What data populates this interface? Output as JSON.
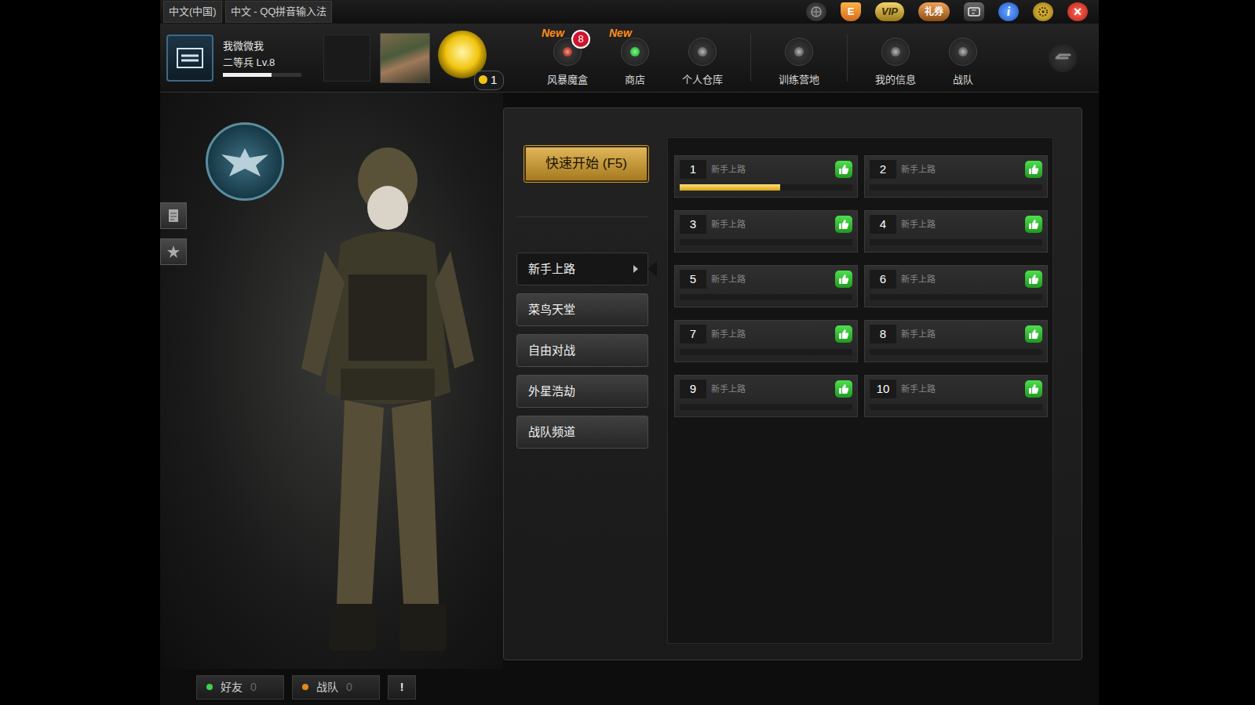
{
  "ime": [
    "中文(中国)",
    "中文 - QQ拼音输入法"
  ],
  "systemIcons": [
    {
      "kind": "globe"
    },
    {
      "kind": "badge",
      "label": "E"
    },
    {
      "kind": "pill",
      "label": "VIP"
    },
    {
      "kind": "pillalt",
      "label": "礼券"
    },
    {
      "kind": "ticket"
    },
    {
      "kind": "info",
      "label": "i"
    },
    {
      "kind": "gear"
    },
    {
      "kind": "close",
      "label": "×"
    }
  ],
  "player": {
    "name": "我微微我",
    "rank": "二等兵 Lv.8",
    "xp": 0.62
  },
  "coins": {
    "count": "1"
  },
  "nav": [
    {
      "label": "风暴魔盒",
      "tag": "New",
      "badge": "8",
      "color": "#c0392b"
    },
    {
      "label": "商店",
      "tag": "New",
      "color": "#2ecc40"
    },
    {
      "label": "个人仓库",
      "color": "#6a6a6a"
    },
    {
      "label": "训练营地",
      "color": "#6a6a6a"
    },
    {
      "label": "我的信息",
      "color": "#6a6a6a"
    },
    {
      "label": "战队",
      "color": "#6a6a6a"
    }
  ],
  "lobby": {
    "quickStart": "快速开始 (F5)",
    "channels": [
      {
        "label": "新手上路",
        "selected": true
      },
      {
        "label": "菜鸟天堂",
        "selected": false
      },
      {
        "label": "自由对战",
        "selected": false
      },
      {
        "label": "外星浩劫",
        "selected": false
      },
      {
        "label": "战队频道",
        "selected": false
      }
    ],
    "rooms": [
      {
        "number": "1",
        "mode": "新手上路",
        "level": 0.58
      },
      {
        "number": "2",
        "mode": "新手上路",
        "level": 0
      },
      {
        "number": "3",
        "mode": "新手上路",
        "level": 0
      },
      {
        "number": "4",
        "mode": "新手上路",
        "level": 0
      },
      {
        "number": "5",
        "mode": "新手上路",
        "level": 0
      },
      {
        "number": "6",
        "mode": "新手上路",
        "level": 0
      },
      {
        "number": "7",
        "mode": "新手上路",
        "level": 0
      },
      {
        "number": "8",
        "mode": "新手上路",
        "level": 0
      },
      {
        "number": "9",
        "mode": "新手上路",
        "level": 0
      },
      {
        "number": "10",
        "mode": "新手上路",
        "level": 0
      }
    ]
  },
  "bottom": {
    "items": [
      {
        "label": "好友",
        "count": "0",
        "color": "#3fcf50"
      },
      {
        "label": "战队",
        "count": "0",
        "color": "#e08a20"
      }
    ],
    "alert": "!"
  }
}
